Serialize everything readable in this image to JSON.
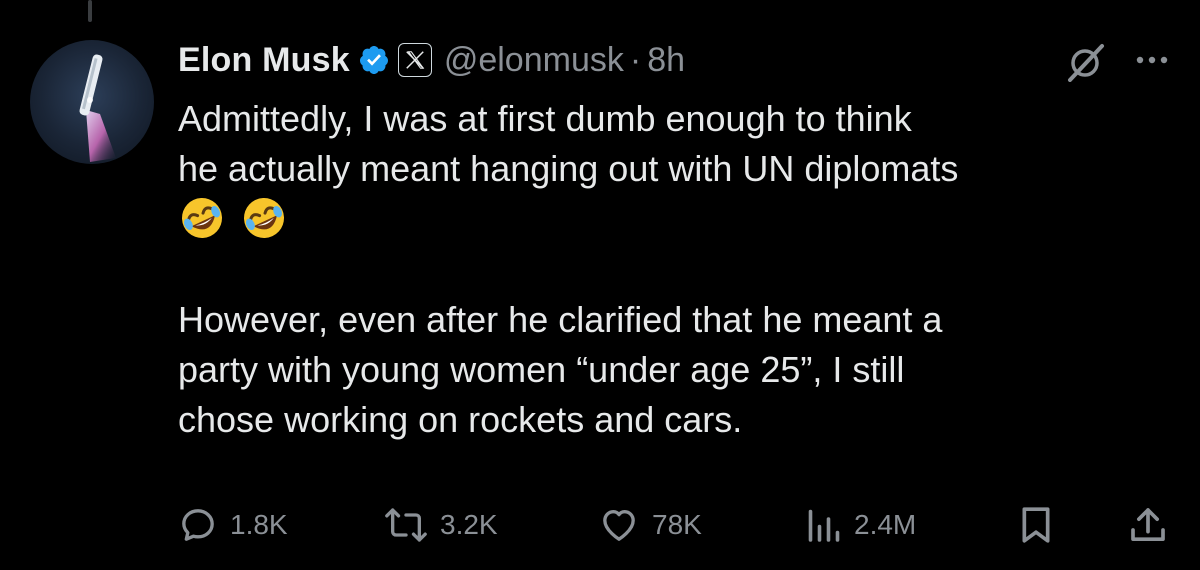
{
  "tweet": {
    "author": {
      "display_name": "Elon Musk",
      "handle": "@elonmusk",
      "verified": true,
      "affiliation_badge": "x-logo-icon"
    },
    "separator": "·",
    "timestamp": "8h",
    "text_line_1": "Admittedly, I was at first dumb enough to think",
    "text_line_2": "he actually meant hanging out with UN diplomats",
    "emoji": [
      "rolling-on-floor-laughing-emoji",
      "rolling-on-floor-laughing-emoji"
    ],
    "text_line_4": "However, even after he clarified that he meant a",
    "text_line_5": "party with young women “under age 25”, I still",
    "text_line_6": "chose working on rockets and cars."
  },
  "actions": {
    "replies": "1.8K",
    "reposts": "3.2K",
    "likes": "78K",
    "views": "2.4M"
  },
  "colors": {
    "background": "#000000",
    "text_primary": "#e7e9ea",
    "text_secondary": "#8b9096",
    "verified_blue": "#1d9bf0"
  },
  "icons": {
    "grok": "grok-icon",
    "more": "more-icon",
    "reply": "reply-icon",
    "repost": "repost-icon",
    "like": "heart-icon",
    "views": "views-icon",
    "bookmark": "bookmark-icon",
    "share": "share-icon"
  }
}
